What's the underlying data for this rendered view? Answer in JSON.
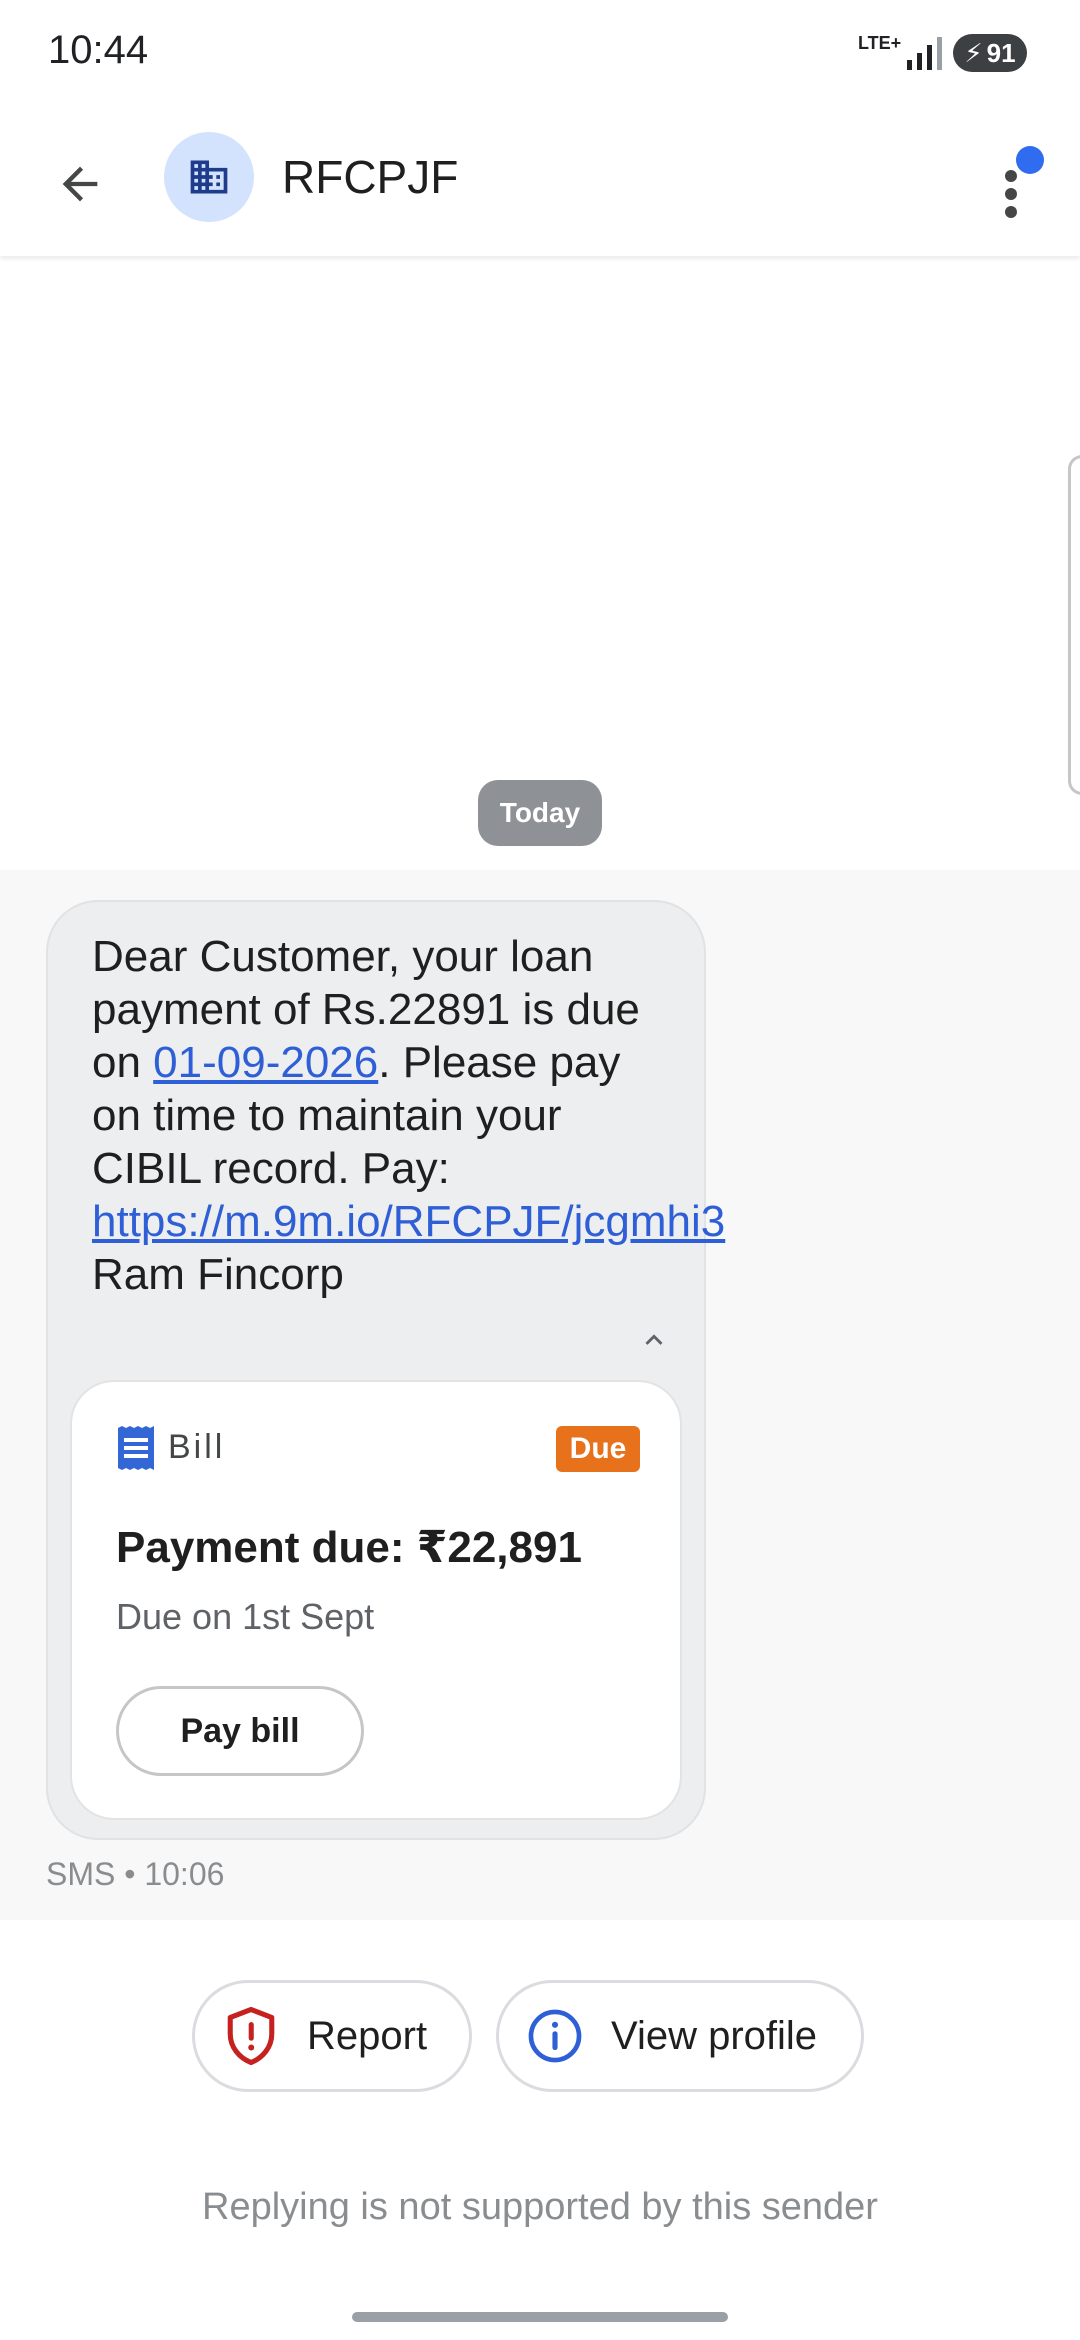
{
  "status_bar": {
    "time": "10:44",
    "network": "LTE+",
    "battery": "91"
  },
  "header": {
    "sender": "RFCPJF",
    "avatar_icon": "business-icon",
    "accent_color": "#2f6cf0"
  },
  "conversation": {
    "date_chip": "Today",
    "message": {
      "part1": "Dear Customer, your loan payment of Rs.22891 is due on ",
      "date_link": "01-09-2026",
      "part2": ". Please pay on time to maintain your CIBIL record. Pay: ",
      "url": "https://m.9m.io/RFCPJF/jcgmhi3",
      "part3": " Ram Fincorp"
    },
    "bill_card": {
      "label": "Bill",
      "status": "Due",
      "status_color": "#e8711c",
      "amount": "Payment due: ₹22,891",
      "due_on": "Due on 1st Sept",
      "pay_button": "Pay bill"
    },
    "meta": "SMS • 10:06"
  },
  "actions": {
    "report": "Report",
    "view_profile": "View profile"
  },
  "footer": {
    "reply_note": "Replying is not supported by this sender"
  }
}
